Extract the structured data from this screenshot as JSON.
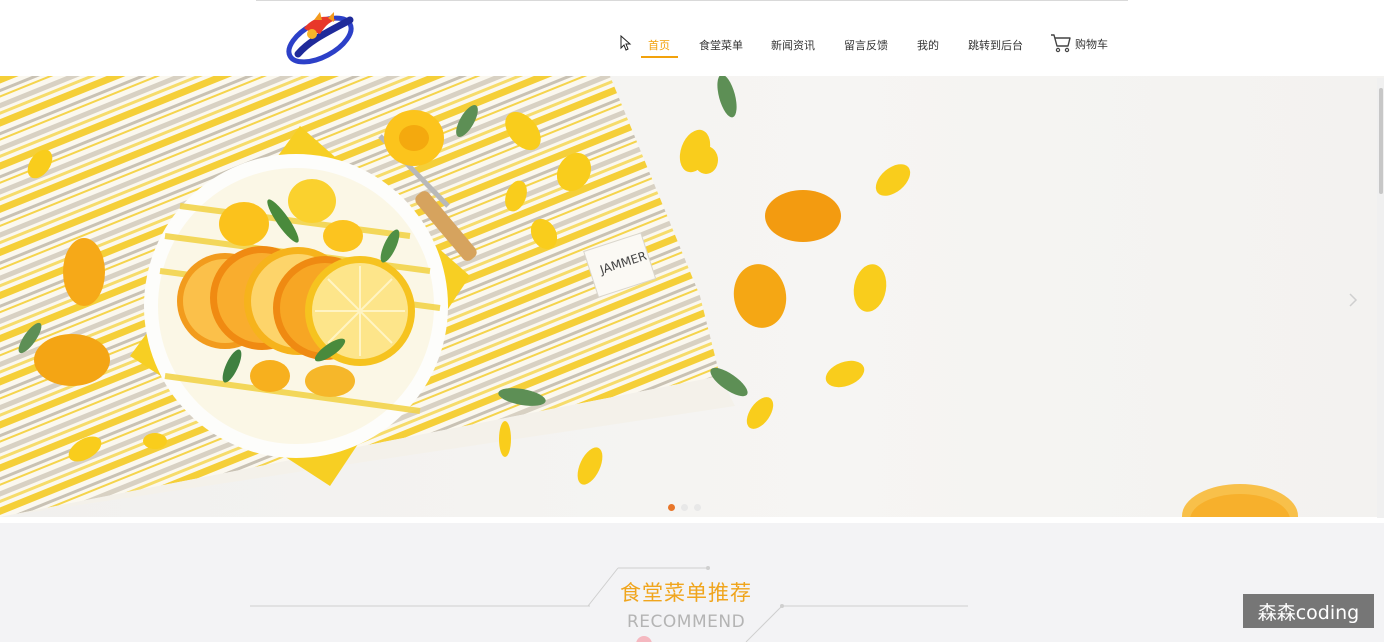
{
  "nav": {
    "items": [
      "首页",
      "食堂菜单",
      "新闻资讯",
      "留言反馈",
      "我的",
      "跳转到后台"
    ],
    "active": "首页",
    "cart_label": "购物车",
    "accent": "#f2a20c"
  },
  "banner": {
    "tag_text": "JAMMER",
    "slide_count": 3,
    "active_slide": 1
  },
  "recommend": {
    "title": "食堂菜单推荐",
    "subtitle": "RECOMMEND"
  },
  "watermark": "森森coding",
  "icons": [
    "logo-icon",
    "cursor-icon",
    "cart-icon",
    "next-arrow-icon"
  ]
}
